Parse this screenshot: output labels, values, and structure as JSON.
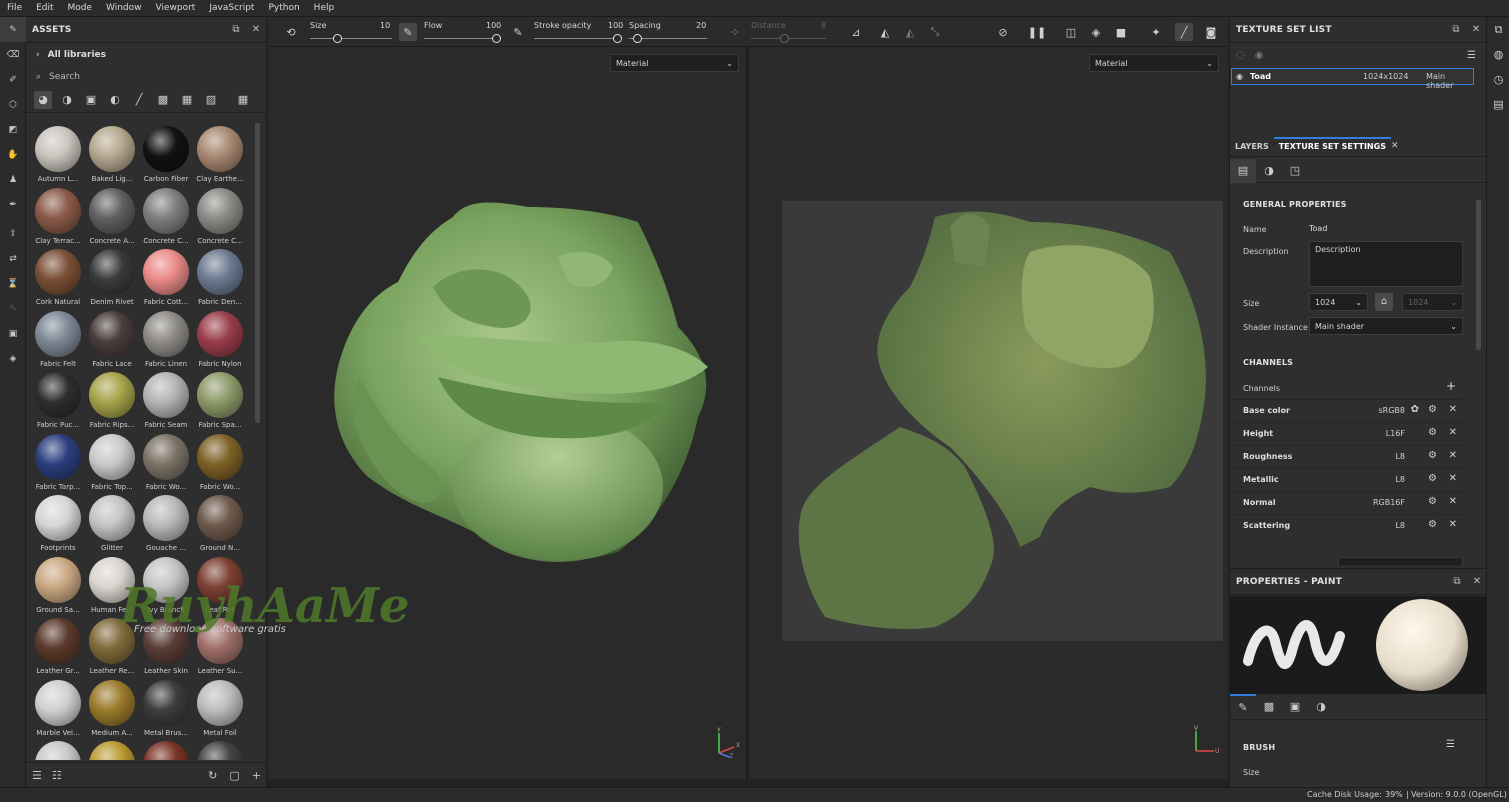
{
  "menu": [
    "File",
    "Edit",
    "Mode",
    "Window",
    "Viewport",
    "JavaScript",
    "Python",
    "Help"
  ],
  "assets": {
    "title": "ASSETS",
    "library": "All libraries",
    "search_placeholder": "Search",
    "materials": [
      "Autumn L...",
      "Baked Lig...",
      "Carbon Fiber",
      "Clay Earthe...",
      "Clay Terrac...",
      "Concrete A...",
      "Concrete C...",
      "Concrete C...",
      "Cork Natural",
      "Denim Rivet",
      "Fabric Cott...",
      "Fabric Den...",
      "Fabric Felt",
      "Fabric Lace",
      "Fabric Linen",
      "Fabric Nylon",
      "Fabric Puc...",
      "Fabric Rips...",
      "Fabric Seam",
      "Fabric Spa...",
      "Fabric Tarp...",
      "Fabric Top...",
      "Fabric Wo...",
      "Fabric Wo...",
      "Footprints",
      "Glitter",
      "Gouache ...",
      "Ground N...",
      "Ground Sa...",
      "Human Fe...",
      "Ivy Branch",
      "Leaf Rot",
      "Leather Gr...",
      "Leather Re...",
      "Leather Skin",
      "Leather Su...",
      "Marble Vei...",
      "Medium A...",
      "Metal Brus...",
      "Metal Foil",
      "",
      "",
      "",
      ""
    ],
    "ball_colors": [
      "#c9c4bd",
      "#b7a890",
      "#121212",
      "#a88972",
      "#8a5a48",
      "#5e6062",
      "#7e7e7e",
      "#8c8a86",
      "#7b5036",
      "#3b3b3b",
      "#e98a88",
      "#6c7b91",
      "#7d8896",
      "#4a3e3d",
      "#8e8b87",
      "#9a3e4a",
      "#2e2e2e",
      "#a7a24a",
      "#b4b4b4",
      "#8e9a6a",
      "#2b3f7e",
      "#c9c9c9",
      "#7c7367",
      "#7d6126",
      "#d6d6d6",
      "#c4c4c4",
      "#b9b9b9",
      "#6e5a4c",
      "#c9a882",
      "#d9d4ce",
      "#c4c4c4",
      "#7d4034",
      "#5b3a2b",
      "#806a3a",
      "#5a3d36",
      "#a06f6a",
      "#d0d0d0",
      "#9a7a2a",
      "#3d3d3d",
      "#bcbcbc",
      "#c8c8c8",
      "#b89a32",
      "#7a3326",
      "#444444"
    ]
  },
  "toolbar": {
    "size_label": "Size",
    "size_value": "10",
    "flow_label": "Flow",
    "flow_value": "100",
    "opacity_label": "Stroke opacity",
    "opacity_value": "100",
    "spacing_label": "Spacing",
    "spacing_value": "20",
    "distance_label": "Distance",
    "distance_value": "8"
  },
  "viewport": {
    "left_mode": "Material",
    "right_mode": "Material",
    "watermark_title": "RuyhAaMe",
    "watermark_sub": "Free download software gratis",
    "axis_y": "Y",
    "axis_x": "X",
    "axis_z": "Z",
    "axis_v": "V",
    "axis_u": "U"
  },
  "texture_set_list": {
    "title": "TEXTURE SET LIST",
    "set_name": "Toad",
    "set_size": "1024x1024",
    "set_shader": "Main shader"
  },
  "tabs": {
    "layers": "LAYERS",
    "tss": "TEXTURE SET SETTINGS"
  },
  "general": {
    "title": "GENERAL PROPERTIES",
    "name_label": "Name",
    "name_value": "Toad",
    "desc_label": "Description",
    "desc_value": "Description",
    "size_label": "Size",
    "size_value": "1024",
    "size_value2": "1024",
    "shader_label": "Shader Instance",
    "shader_value": "Main shader"
  },
  "channels": {
    "title": "CHANNELS",
    "label": "Channels",
    "list": [
      {
        "name": "Base color",
        "format": "sRGB8"
      },
      {
        "name": "Height",
        "format": "L16F"
      },
      {
        "name": "Roughness",
        "format": "L8"
      },
      {
        "name": "Metallic",
        "format": "L8"
      },
      {
        "name": "Normal",
        "format": "RGB16F"
      },
      {
        "name": "Scattering",
        "format": "L8"
      }
    ]
  },
  "properties": {
    "title": "PROPERTIES - PAINT",
    "brush_title": "BRUSH",
    "size_label": "Size"
  },
  "status": {
    "cache_label": "Cache Disk Usage:",
    "cache_value": "39%",
    "version": "Version: 9.0.0 (OpenGL)"
  }
}
